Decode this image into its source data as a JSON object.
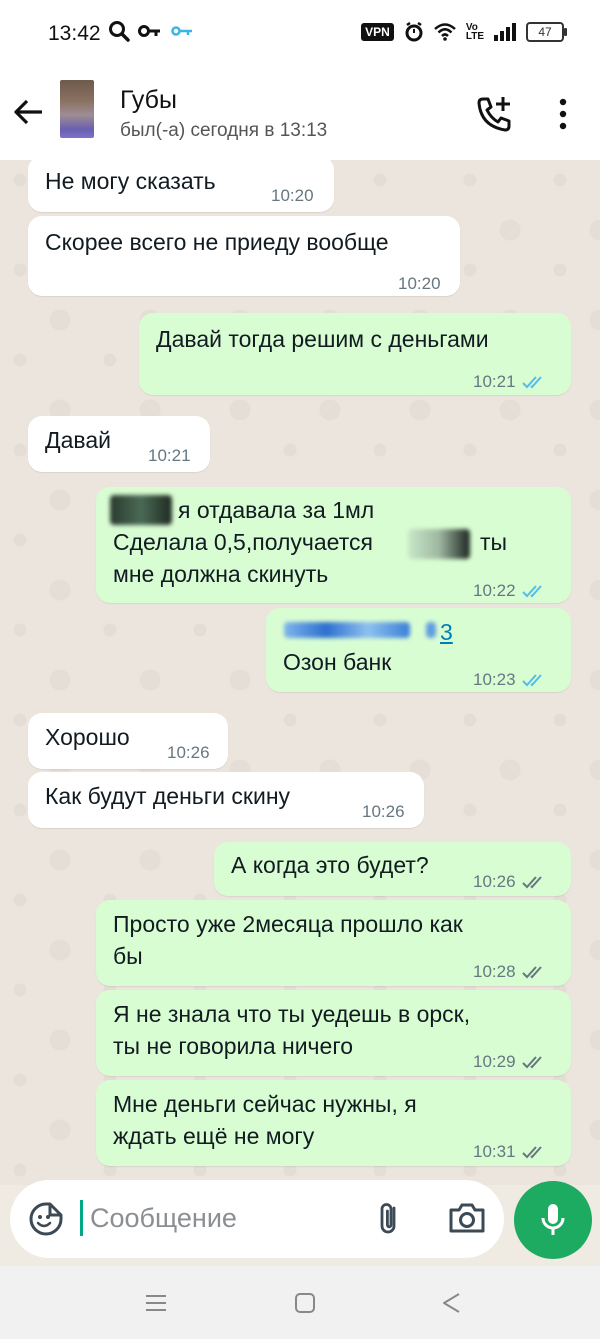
{
  "status_bar": {
    "time": "13:42",
    "vpn": "VPN",
    "volte_top": "Vo",
    "volte_bottom": "LTE",
    "battery": "47"
  },
  "header": {
    "contact_name": "Губы",
    "last_seen": "был(-а) сегодня в 13:13"
  },
  "messages": [
    {
      "dir": "in",
      "text": "Не могу сказать",
      "time": "10:20"
    },
    {
      "dir": "in",
      "text": "Скорее всего не приеду вообще",
      "time": "10:20"
    },
    {
      "dir": "out",
      "text": "Давай тогда решим с деньгами",
      "time": "10:21",
      "status": "read"
    },
    {
      "dir": "in",
      "text": "Давай",
      "time": "10:21"
    },
    {
      "dir": "out",
      "line1": "я отдавала за 1мл",
      "line2": "Сделала 0,5,получается",
      "line2_end": "ты",
      "line3": "мне должна скинуть",
      "time": "10:22",
      "status": "read"
    },
    {
      "dir": "out",
      "link_suffix": "3",
      "text": "Озон банк",
      "time": "10:23",
      "status": "read"
    },
    {
      "dir": "in",
      "text": "Хорошо",
      "time": "10:26"
    },
    {
      "dir": "in",
      "text": "Как будут деньги скину",
      "time": "10:26"
    },
    {
      "dir": "out",
      "text": "А когда это будет?",
      "time": "10:26",
      "status": "delivered"
    },
    {
      "dir": "out",
      "line1": "Просто уже 2месяца прошло как",
      "line2": "бы",
      "time": "10:28",
      "status": "delivered"
    },
    {
      "dir": "out",
      "line1": "Я не знала что ты уедешь в орск,",
      "line2": "ты не говорила ничего",
      "time": "10:29",
      "status": "delivered"
    },
    {
      "dir": "out",
      "line1": "Мне деньги сейчас нужны, я",
      "line2": "ждать ещё не могу",
      "time": "10:31",
      "status": "delivered"
    }
  ],
  "input": {
    "placeholder": "Сообщение"
  },
  "colors": {
    "incoming": "#ffffff",
    "outgoing": "#d9fdd3",
    "read_tick": "#53bdeb",
    "delivered_tick": "#667781",
    "accent": "#1daa61"
  }
}
